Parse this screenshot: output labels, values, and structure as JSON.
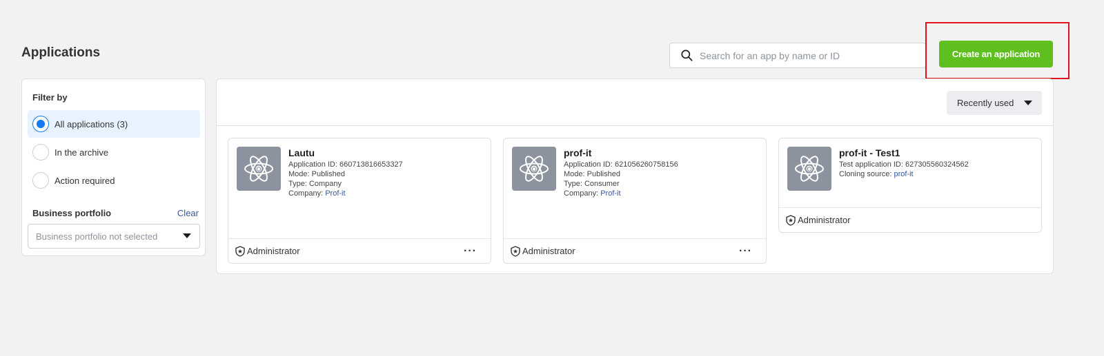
{
  "page": {
    "title": "Applications"
  },
  "search": {
    "placeholder": "Search for an app by name or ID"
  },
  "create_button": {
    "label": "Create an application",
    "color": "#5fbf1f"
  },
  "filter": {
    "title": "Filter by",
    "options": [
      {
        "label": "All applications (3)",
        "selected": true
      },
      {
        "label": "In the archive",
        "selected": false
      },
      {
        "label": "Action required",
        "selected": false
      }
    ],
    "business_portfolio": {
      "label": "Business portfolio",
      "clear_label": "Clear",
      "select_value": "Business portfolio not selected"
    }
  },
  "sort": {
    "label": "Recently used"
  },
  "apps": [
    {
      "name": "Lautu",
      "id_line": "Application ID: 660713816653327",
      "mode_line": "Mode: Published",
      "type_line": "Type: Company",
      "company_label": "Company: ",
      "company_link": "Prof-it",
      "role": "Administrator"
    },
    {
      "name": "prof-it",
      "id_line": "Application ID: 621056260758156",
      "mode_line": "Mode: Published",
      "type_line": "Type: Consumer",
      "company_label": "Company: ",
      "company_link": "Prof-it",
      "role": "Administrator"
    },
    {
      "name": "prof-it - Test1",
      "id_line": "Test application ID: 627305560324562",
      "cloning_label": "Cloning source: ",
      "cloning_link": "prof-it",
      "role": "Administrator"
    }
  ],
  "colors": {
    "accent": "#1877f2",
    "link": "#385898",
    "highlight": "#e0141e",
    "app_icon_bg": "#8c939f"
  }
}
